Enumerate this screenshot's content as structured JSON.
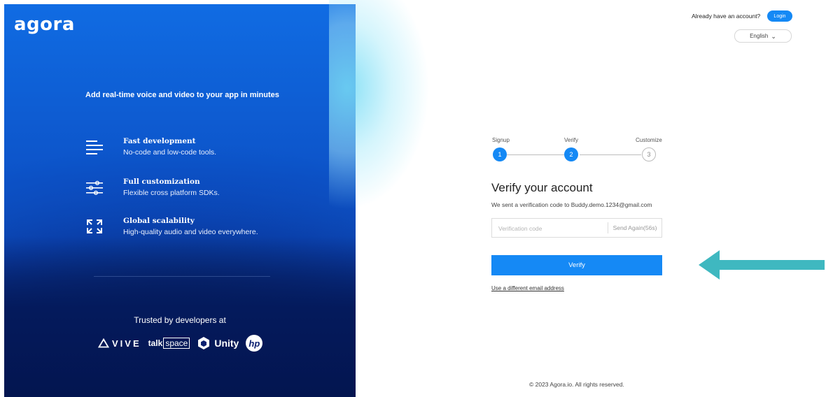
{
  "left": {
    "logo": "agora",
    "tagline": "Add real-time voice and video to your app in minutes",
    "features": [
      {
        "icon": "menu-lines-icon",
        "title": "Fast development",
        "desc": "No-code and low-code tools."
      },
      {
        "icon": "sliders-icon",
        "title": "Full customization",
        "desc": "Flexible cross platform SDKs."
      },
      {
        "icon": "expand-arrows-icon",
        "title": "Global scalability",
        "desc": "High-quality audio and video everywhere."
      }
    ],
    "trusted": "Trusted by developers at",
    "brands": {
      "vive": "VIVE",
      "talk_a": "talk",
      "talk_b": "space",
      "unity": "Unity",
      "hp": "hp"
    }
  },
  "header": {
    "already": "Already have an account?",
    "login": "Login",
    "language": "English",
    "language_chevron": "⌄"
  },
  "stepper": {
    "steps": [
      {
        "label": "Signup",
        "num": "1",
        "state": "active"
      },
      {
        "label": "Verify",
        "num": "2",
        "state": "active"
      },
      {
        "label": "Customize",
        "num": "3",
        "state": "pending"
      }
    ]
  },
  "form": {
    "title": "Verify your account",
    "subtitle": "We sent a verification code to Buddy.demo.1234@gmail.com",
    "code_placeholder": "Verification code",
    "send_again": "Send Again(56s)",
    "verify": "Verify",
    "different_email": "Use a different email address"
  },
  "footer": {
    "copyright": "© 2023 Agora.io. All rights reserved."
  },
  "colors": {
    "accent": "#1589f5",
    "panel_dark": "#041a5c",
    "annotation_arrow": "#3fb8c0"
  }
}
